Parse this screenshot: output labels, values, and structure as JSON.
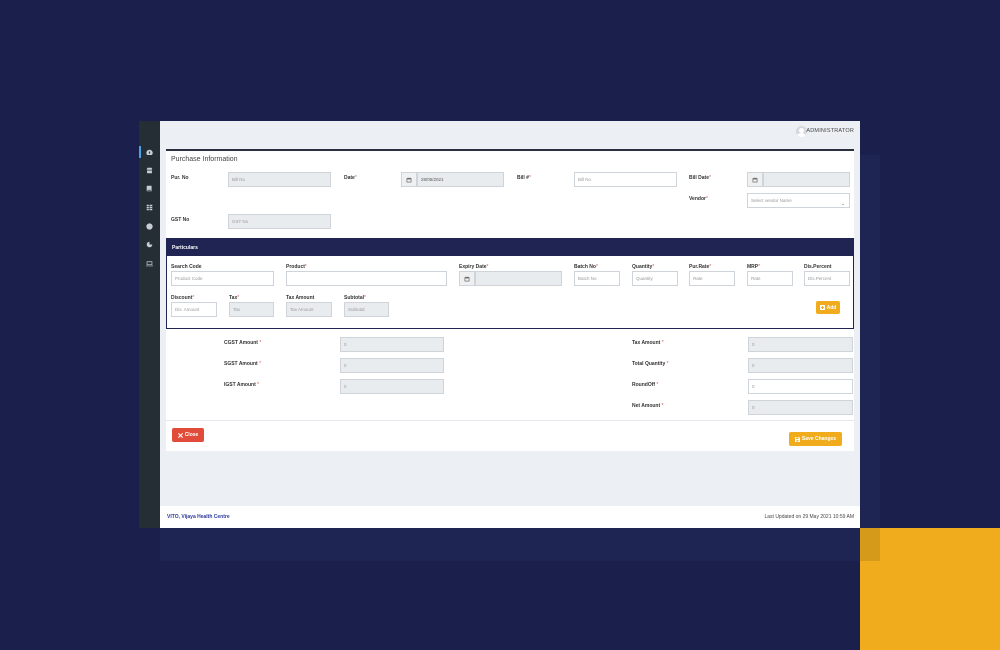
{
  "header": {
    "user_name": "ADMINISTRATOR"
  },
  "sidebar": {
    "icons": [
      "dashboard-icon",
      "store-icon",
      "book-icon",
      "grid-icon",
      "alert-icon",
      "chart-icon",
      "monitor-icon"
    ]
  },
  "form": {
    "title": "Purchase Information",
    "pur_no": {
      "label": "Pur. No",
      "placeholder": "Bill No"
    },
    "date": {
      "label": "Date",
      "value": "28/05/2021"
    },
    "bill_no": {
      "label": "Bill #",
      "placeholder": "Bill No"
    },
    "bill_date": {
      "label": "Bill Date"
    },
    "vendor": {
      "label": "Vendor",
      "placeholder": "Select vendor Name"
    },
    "gst_no": {
      "label": "GST No",
      "placeholder": "GST No"
    }
  },
  "particulars": {
    "title": "Particulars",
    "search_code": {
      "label": "Search Code",
      "placeholder": "Product Code"
    },
    "product": {
      "label": "Product"
    },
    "expiry_date": {
      "label": "Expiry Date"
    },
    "batch_no": {
      "label": "Batch No",
      "placeholder": "Batch No"
    },
    "quantity": {
      "label": "Quantity",
      "placeholder": "Quantity"
    },
    "pur_rate": {
      "label": "Pur.Rate",
      "placeholder": "Rate"
    },
    "mrp": {
      "label": "MRP",
      "placeholder": "Rate"
    },
    "dis_percent": {
      "label": "Dis.Percent",
      "placeholder": "Dis.Percent"
    },
    "discount": {
      "label": "Discount",
      "placeholder": "Dis. Amount"
    },
    "tax": {
      "label": "Tax",
      "placeholder": "Tax"
    },
    "tax_amount": {
      "label": "Tax Amount",
      "placeholder": "Tax Amount"
    },
    "subtotal": {
      "label": "Subtotal",
      "placeholder": "Subtotal"
    },
    "add_label": "Add"
  },
  "totals": {
    "cgst": {
      "label": "CGST Amount",
      "value": "0"
    },
    "sgst": {
      "label": "SGST Amount",
      "value": "0"
    },
    "igst": {
      "label": "IGST Amount",
      "value": "0"
    },
    "tax_amount": {
      "label": "Tax Amount",
      "value": "0"
    },
    "total_quantity": {
      "label": "Total Quantity",
      "value": "0"
    },
    "roundoff": {
      "label": "RoundOff",
      "value": "0"
    },
    "net_amount": {
      "label": "Net Amount",
      "value": "0"
    }
  },
  "actions": {
    "close_label": "Close",
    "save_label": "Save Changes"
  },
  "footer": {
    "brand": "VITO, Vijaya Health Centre",
    "updated": "Last Updated on 29 May 2021 10:59 AM"
  },
  "colors": {
    "navy": "#1f2453",
    "accent_yellow": "#f0ac1c",
    "danger": "#e04b3a",
    "sidebar": "#252e35"
  }
}
